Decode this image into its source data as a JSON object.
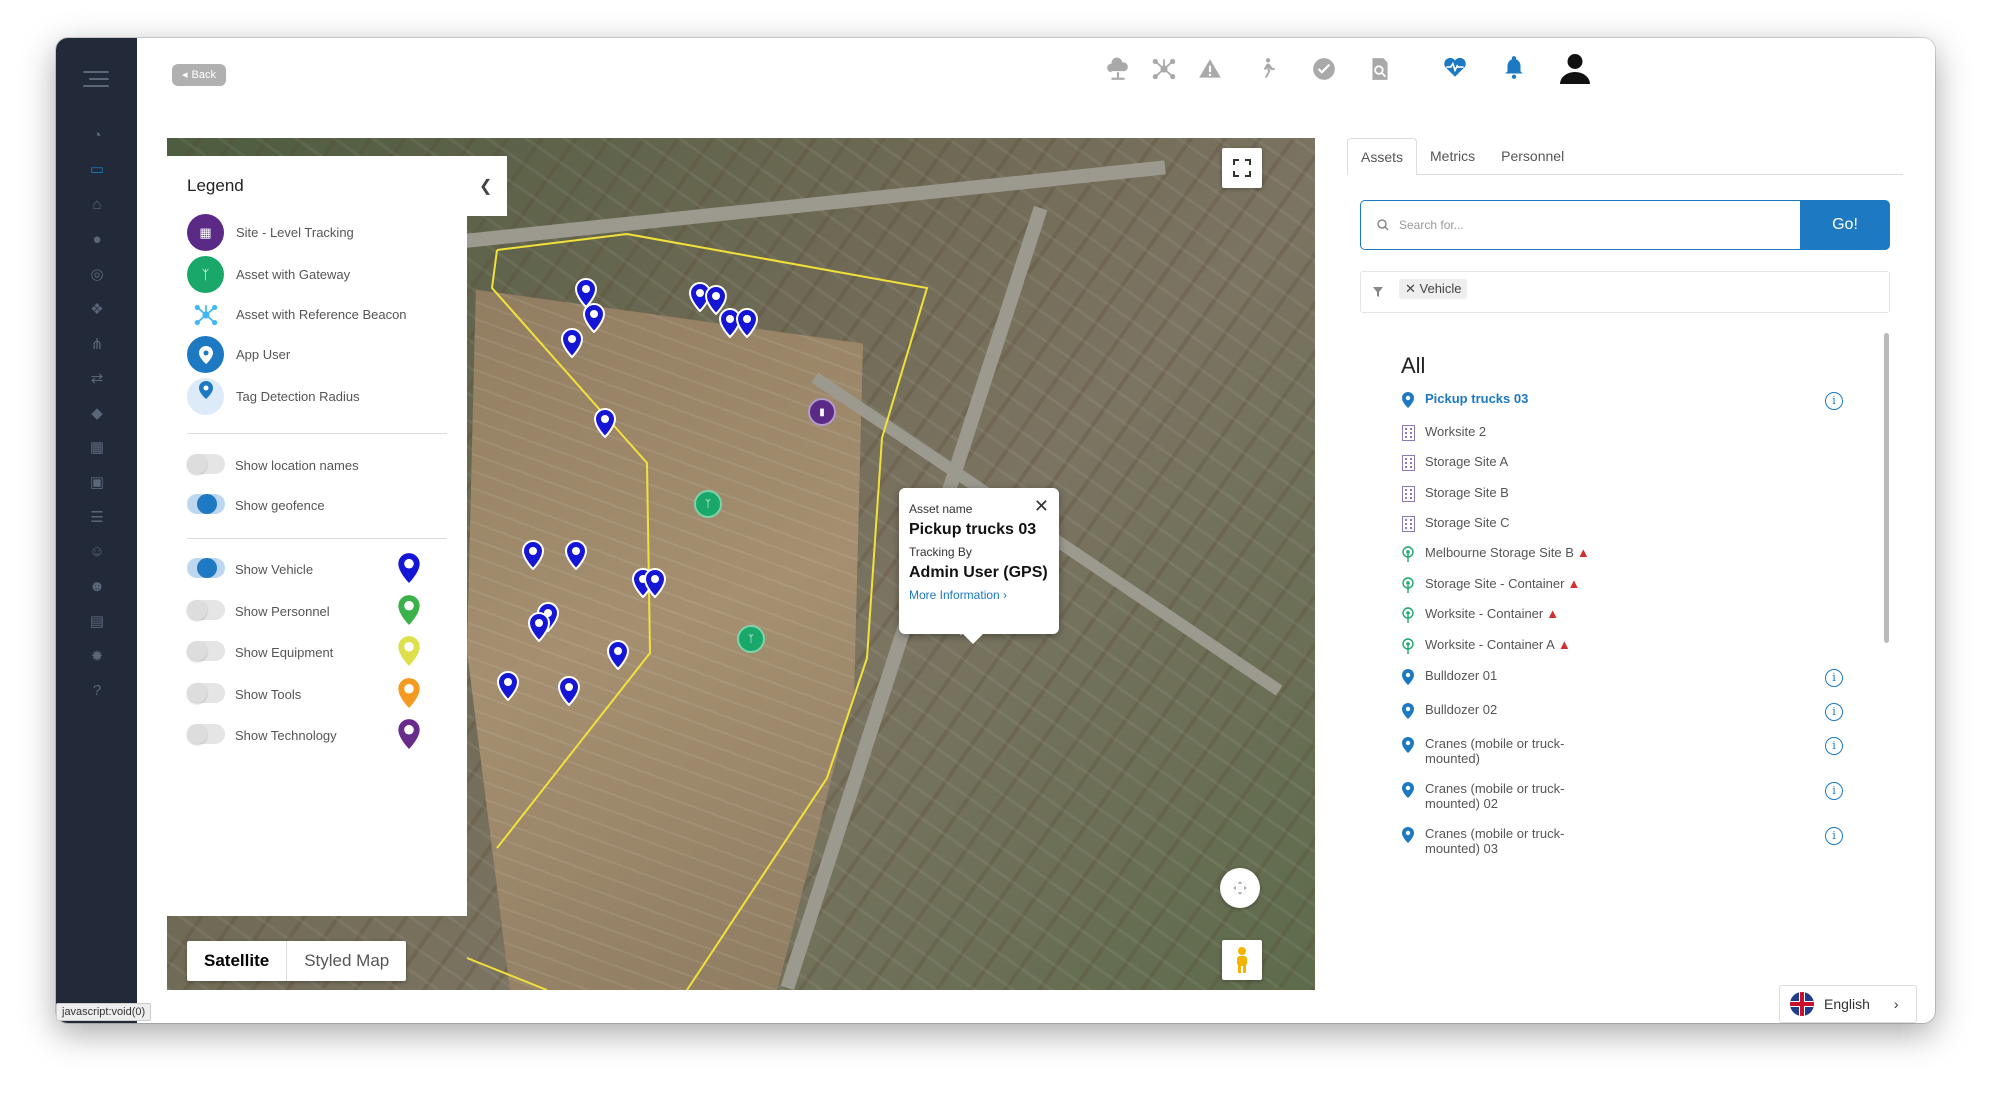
{
  "header": {
    "back_label": "Back",
    "icons": [
      "cloud-network-icon",
      "hub-icon",
      "warning-icon",
      "person-walking-icon",
      "check-circle-icon",
      "search-document-icon",
      "heart-pulse-icon",
      "bell-icon",
      "user-avatar-icon"
    ]
  },
  "sidebar": {
    "icons": [
      "dashboard-icon",
      "monitor-icon",
      "home-icon",
      "location-icon",
      "radar-icon",
      "tags-icon",
      "hierarchy-icon",
      "shuffle-icon",
      "tag-icon",
      "calendar-icon",
      "briefcase-icon",
      "list-icon",
      "person-icon",
      "person-tag-icon",
      "report-icon",
      "settings-icon",
      "help-icon"
    ]
  },
  "legend": {
    "title": "Legend",
    "items": [
      {
        "label": "Site - Level Tracking",
        "color": "#5b2a86"
      },
      {
        "label": "Asset with Gateway",
        "color": "#1aa86a"
      },
      {
        "label": "Asset with Reference Beacon",
        "color": "#3fb8f5"
      },
      {
        "label": "App User",
        "color": "#1c79c2"
      },
      {
        "label": "Tag Detection Radius",
        "color": "#1c79c2"
      }
    ],
    "toggles": [
      {
        "label": "Show location names",
        "on": false
      },
      {
        "label": "Show geofence",
        "on": true
      }
    ],
    "layer_toggles": [
      {
        "label": "Show Vehicle",
        "on": true,
        "pin_color": "#1515d6"
      },
      {
        "label": "Show Personnel",
        "on": false,
        "pin_color": "#3bb14a"
      },
      {
        "label": "Show Equipment",
        "on": false,
        "pin_color": "#dde04a"
      },
      {
        "label": "Show Tools",
        "on": false,
        "pin_color": "#f39a1f"
      },
      {
        "label": "Show Technology",
        "on": false,
        "pin_color": "#6a2c8c"
      }
    ]
  },
  "map": {
    "type_active": "Satellite",
    "type_other": "Styled Map",
    "infowindow": {
      "asset_label": "Asset name",
      "asset_name": "Pickup trucks 03",
      "tracking_label": "Tracking By",
      "tracking_value": "Admin User (GPS)",
      "link": "More Information ›"
    }
  },
  "panel": {
    "tabs": [
      "Assets",
      "Metrics",
      "Personnel"
    ],
    "search_placeholder": "Search for...",
    "go_label": "Go!",
    "filter_chip": "Vehicle",
    "list_heading": "All",
    "items": [
      {
        "label": "Pickup trucks 03",
        "kind": "pin",
        "info": true,
        "warn": false,
        "selected": true
      },
      {
        "label": "Worksite 2",
        "kind": "building",
        "info": false,
        "warn": false
      },
      {
        "label": "Storage Site A",
        "kind": "building",
        "info": false,
        "warn": false
      },
      {
        "label": "Storage Site B",
        "kind": "building",
        "info": false,
        "warn": false
      },
      {
        "label": "Storage Site C",
        "kind": "building",
        "info": false,
        "warn": false
      },
      {
        "label": "Melbourne Storage Site B",
        "kind": "gateway",
        "info": false,
        "warn": true
      },
      {
        "label": "Storage Site - Container",
        "kind": "gateway",
        "info": false,
        "warn": true
      },
      {
        "label": "Worksite - Container",
        "kind": "gateway",
        "info": false,
        "warn": true
      },
      {
        "label": "Worksite - Container A",
        "kind": "gateway",
        "info": false,
        "warn": true
      },
      {
        "label": "Bulldozer 01",
        "kind": "pin",
        "info": true,
        "warn": false
      },
      {
        "label": "Bulldozer 02",
        "kind": "pin",
        "info": true,
        "warn": false
      },
      {
        "label": "Cranes (mobile or truck-mounted)",
        "kind": "pin",
        "info": true,
        "warn": false
      },
      {
        "label": "Cranes (mobile or truck-mounted) 02",
        "kind": "pin",
        "info": true,
        "warn": false
      },
      {
        "label": "Cranes (mobile or truck-mounted) 03",
        "kind": "pin",
        "info": true,
        "warn": false
      }
    ]
  },
  "language": "English",
  "statusbar": "javascript:void(0)",
  "colors": {
    "accent": "#1c79c2",
    "sidebar": "#222a3a",
    "warning": "#d32f2f"
  }
}
